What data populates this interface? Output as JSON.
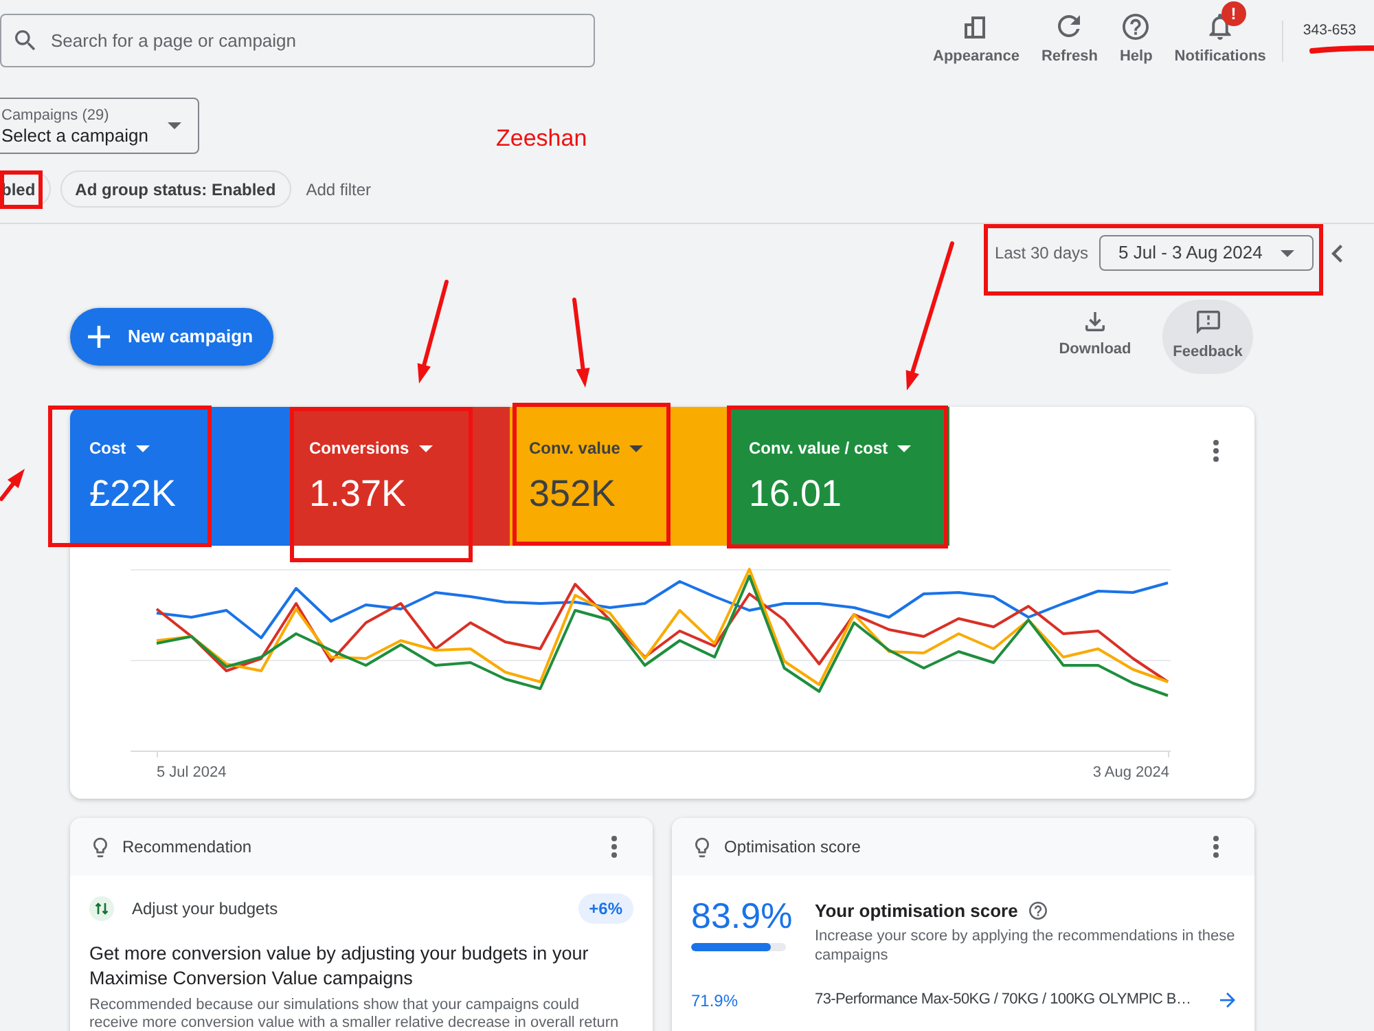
{
  "search": {
    "placeholder": "Search for a page or campaign"
  },
  "toolbar": [
    {
      "kind": "appearance",
      "label": "Appearance"
    },
    {
      "kind": "refresh",
      "label": "Refresh"
    },
    {
      "kind": "help",
      "label": "Help"
    },
    {
      "kind": "notifications",
      "label": "Notifications",
      "badge": "!"
    }
  ],
  "account": {
    "number": "343-653"
  },
  "campaign_picker": {
    "label": "Campaigns (29)",
    "value": "Select a campaign"
  },
  "annotation": {
    "text": "Zeeshan"
  },
  "filters": [
    {
      "label": "bled"
    },
    {
      "label": "Ad group status: Enabled"
    }
  ],
  "add_filter": "Add filter",
  "date_range": {
    "preset": "Last 30 days",
    "value": "5 Jul - 3 Aug 2024"
  },
  "new_campaign_button": "New campaign",
  "actions": [
    {
      "kind": "download",
      "label": "Download",
      "hovered": false
    },
    {
      "kind": "feedback",
      "label": "Feedback",
      "hovered": true
    }
  ],
  "metrics": [
    {
      "label": "Cost",
      "value": "£22K",
      "color": "#1a73e8"
    },
    {
      "label": "Conversions",
      "value": "1.37K",
      "color": "#d93025"
    },
    {
      "label": "Conv. value",
      "value": "352K",
      "color": "#f9ab00"
    },
    {
      "label": "Conv. value / cost",
      "value": "16.01",
      "color": "#1e8e3e"
    }
  ],
  "chart": {
    "x_labels": [
      "5 Jul 2024",
      "3 Aug 2024"
    ]
  },
  "recommendation": {
    "title": "Recommendation",
    "item": "Adjust your budgets",
    "uplift": "+6%",
    "headline": "Get more conversion value by adjusting your budgets in your Maximise Conversion Value campaigns",
    "description": "Recommended because our simulations show that your campaigns could receive more conversion value with a smaller relative decrease in overall return"
  },
  "optimisation_score": {
    "title": "Optimisation score",
    "score": "83.9%",
    "level": 0.839,
    "heading": "Your optimisation score",
    "description": "Increase your score by applying the recommendations in these campaigns",
    "campaigns": [
      {
        "score": "71.9%",
        "name": "73-Performance Max-50KG / 70KG / 100KG OLYMPIC B…"
      }
    ]
  }
}
